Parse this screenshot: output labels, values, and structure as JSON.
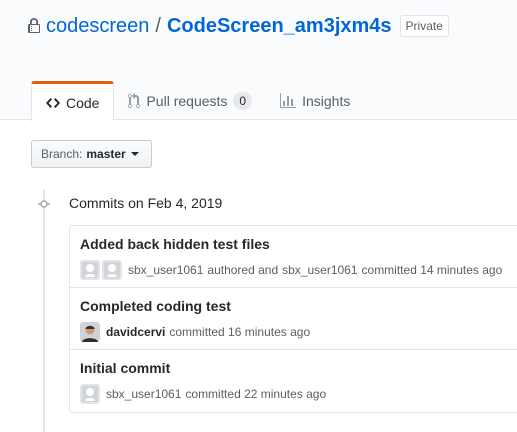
{
  "repo": {
    "owner": "codescreen",
    "separator": "/",
    "name": "CodeScreen_am3jxm4s",
    "visibility": "Private",
    "lock_icon": "lock-icon"
  },
  "tabs": [
    {
      "label": "Code",
      "icon": "code-icon",
      "selected": true
    },
    {
      "label": "Pull requests",
      "icon": "git-pull-request-icon",
      "count": "0"
    },
    {
      "label": "Insights",
      "icon": "graph-icon"
    }
  ],
  "branch": {
    "label": "Branch:",
    "value": "master"
  },
  "commits_group": {
    "date_label": "Commits on Feb 4, 2019"
  },
  "commits": [
    {
      "title": "Added back hidden test files",
      "author": "sbx_user1061",
      "authored_text": "authored and",
      "committer": "sbx_user1061",
      "committed_text": "committed 14 minutes ago",
      "avatar": "identicon"
    },
    {
      "title": "Completed coding test",
      "author": "davidcervi",
      "committed_text": "committed 16 minutes ago",
      "avatar": "user-photo"
    },
    {
      "title": "Initial commit",
      "author": "sbx_user1061",
      "committed_text": "committed 22 minutes ago",
      "avatar": "identicon"
    }
  ],
  "colors": {
    "link": "#0366d6",
    "tab_accent": "#e36209",
    "muted": "#586069",
    "border": "#e1e4e8"
  }
}
